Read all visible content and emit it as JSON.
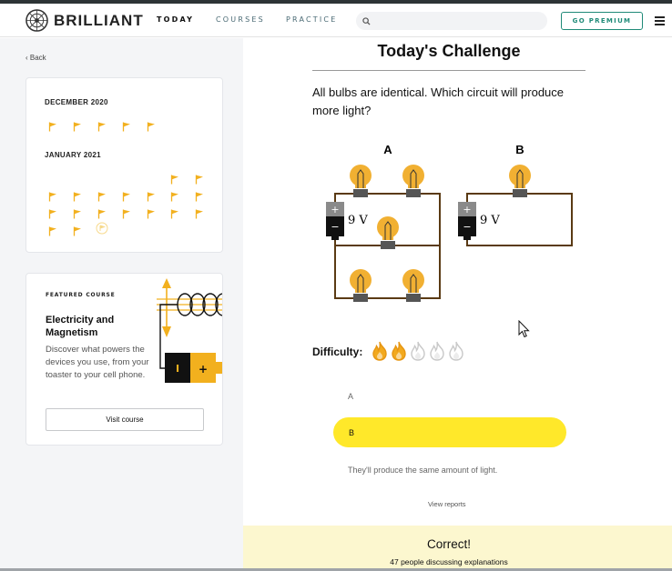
{
  "brand": {
    "name": "BRILLIANT"
  },
  "nav": {
    "today": "TODAY",
    "courses": "COURSES",
    "practice": "PRACTICE"
  },
  "search": {
    "placeholder": ""
  },
  "header": {
    "premium": "GO PREMIUM"
  },
  "sidebar": {
    "back": "Back",
    "calendar": {
      "months": [
        {
          "label": "DECEMBER 2020",
          "completed_days": 5
        },
        {
          "label": "JANUARY 2021",
          "completed_days": 18,
          "pending_days": 1
        }
      ]
    },
    "featured": {
      "label": "FEATURED COURSE",
      "title": "Electricity and Magnetism",
      "description": "Discover what powers the devices you use, from your toaster to your cell phone.",
      "button": "Visit course",
      "art_battery_minus": "I",
      "art_battery_plus": "+"
    }
  },
  "challenge": {
    "title": "Today's Challenge",
    "question": "All bulbs are identical. Which circuit will produce more light?",
    "circuit": {
      "label_a": "A",
      "label_b": "B",
      "voltage_a": "9 V",
      "voltage_b": "9 V",
      "plus": "+",
      "minus": "−"
    },
    "difficulty_label": "Difficulty:",
    "difficulty_level": 2,
    "difficulty_max": 5,
    "answers": [
      "A",
      "B",
      "They'll produce the same amount of light."
    ],
    "selected_answer": "B",
    "view_reports": "View reports",
    "result": {
      "title": "Correct!",
      "subtitle": "47 people discussing explanations"
    }
  },
  "colors": {
    "accent": "#1f8a78",
    "flag": "#f2b01e",
    "selected": "#ffe82a",
    "bulb": "#f1b032",
    "wire": "#5a3a14",
    "correct_bg": "#fcf7cf"
  },
  "icons": {
    "search": "search-icon",
    "menu": "hamburger-icon",
    "flag": "flag-icon",
    "flame": "flame-icon",
    "cursor": "mouse-cursor-icon"
  }
}
